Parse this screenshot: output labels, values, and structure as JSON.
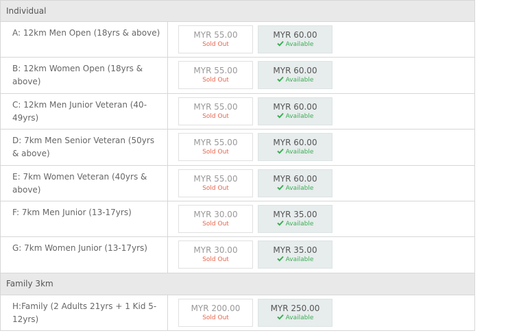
{
  "sections": [
    {
      "title": "Individual",
      "rows": [
        {
          "category": "A: 12km Men Open (18yrs & above)",
          "early_price": "MYR 55.00",
          "early_status": "Sold Out",
          "normal_price": "MYR 60.00",
          "normal_status": "Available"
        },
        {
          "category": "B: 12km Women Open (18yrs & above)",
          "early_price": "MYR 55.00",
          "early_status": "Sold Out",
          "normal_price": "MYR 60.00",
          "normal_status": "Available"
        },
        {
          "category": "C: 12km Men Junior Veteran (40-49yrs)",
          "early_price": "MYR 55.00",
          "early_status": "Sold Out",
          "normal_price": "MYR 60.00",
          "normal_status": "Available"
        },
        {
          "category": "D: 7km Men Senior Veteran (50yrs & above)",
          "early_price": "MYR 55.00",
          "early_status": "Sold Out",
          "normal_price": "MYR 60.00",
          "normal_status": "Available"
        },
        {
          "category": "E: 7km Women Veteran (40yrs & above)",
          "early_price": "MYR 55.00",
          "early_status": "Sold Out",
          "normal_price": "MYR 60.00",
          "normal_status": "Available"
        },
        {
          "category": "F: 7km Men Junior (13-17yrs)",
          "early_price": "MYR 30.00",
          "early_status": "Sold Out",
          "normal_price": "MYR 35.00",
          "normal_status": "Available"
        },
        {
          "category": "G: 7km Women Junior (13-17yrs)",
          "early_price": "MYR 30.00",
          "early_status": "Sold Out",
          "normal_price": "MYR 35.00",
          "normal_status": "Available"
        }
      ]
    },
    {
      "title": "Family 3km",
      "rows": [
        {
          "category": "H:Family (2 Adults 21yrs + 1 Kid 5-12yrs)",
          "early_price": "MYR 200.00",
          "early_status": "Sold Out",
          "normal_price": "MYR 250.00",
          "normal_status": "Available"
        }
      ]
    }
  ],
  "icons": {
    "available_icon": "check-icon"
  },
  "colors": {
    "header_bg": "#e9e9e9",
    "sold_out": "#e8654d",
    "available": "#3aae55",
    "available_bg": "#e7ecec"
  }
}
